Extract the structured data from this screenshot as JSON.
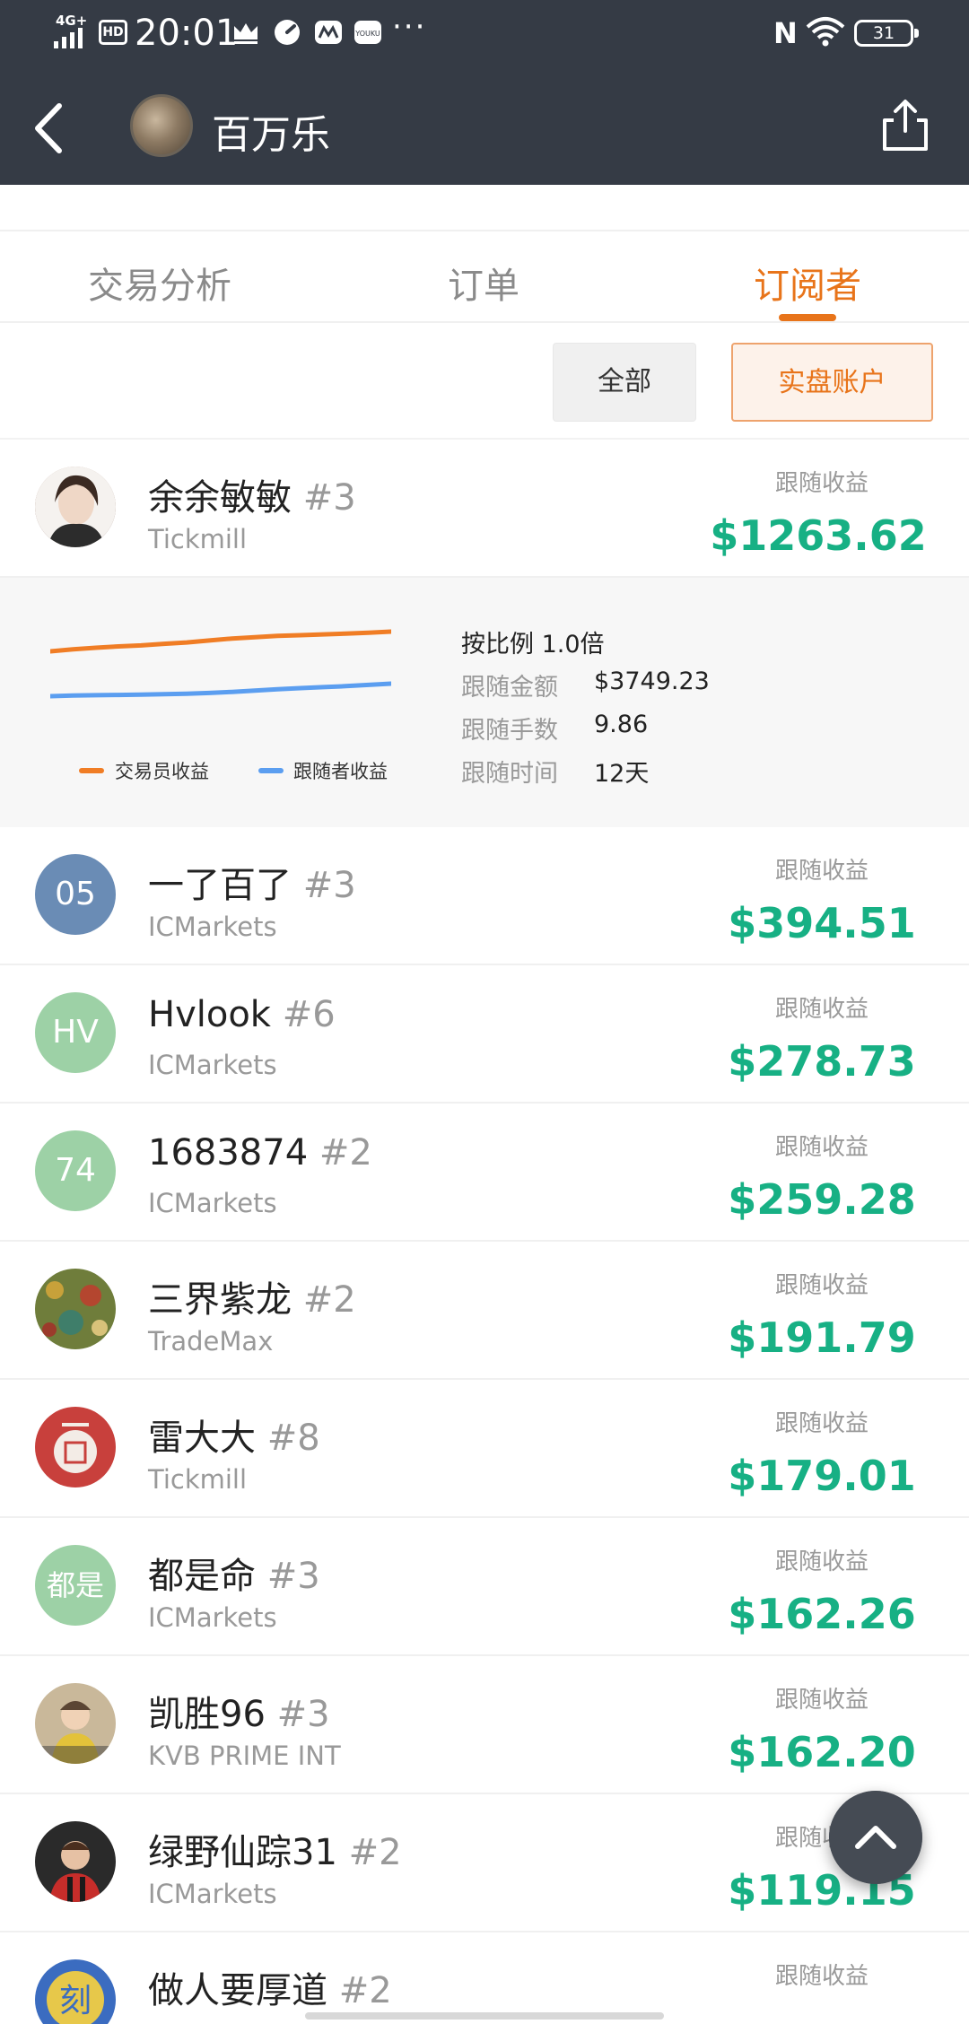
{
  "status_bar": {
    "network": "4G+",
    "hd": "HD",
    "time": "20:01",
    "more": "···",
    "nfc": "N",
    "battery": "31"
  },
  "header": {
    "title": "百万乐",
    "back_icon": "chevron-left-icon",
    "share_icon": "share-icon"
  },
  "tabs": [
    {
      "label": "交易分析",
      "active": false
    },
    {
      "label": "订单",
      "active": false
    },
    {
      "label": "订阅者",
      "active": true
    }
  ],
  "filters": {
    "all": "全部",
    "real_account": "实盘账户",
    "selected": "实盘账户"
  },
  "profit_label": "跟随收益",
  "subscribers": [
    {
      "name": "余余敏敏",
      "rank": "#3",
      "broker": "Tickmill",
      "profit": "$1263.62",
      "avatar_text": "",
      "avatar_color": "#d9c2b2"
    },
    {
      "name": "一了百了",
      "rank": "#3",
      "broker": "ICMarkets",
      "profit": "$394.51",
      "avatar_text": "05",
      "avatar_color": "#6a8cb5"
    },
    {
      "name": "Hvlook",
      "rank": "#6",
      "broker": "ICMarkets",
      "profit": "$278.73",
      "avatar_text": "HV",
      "avatar_color": "#9dd1a6"
    },
    {
      "name": "1683874",
      "rank": "#2",
      "broker": "ICMarkets",
      "profit": "$259.28",
      "avatar_text": "74",
      "avatar_color": "#9dd1a6"
    },
    {
      "name": "三界紫龙",
      "rank": "#2",
      "broker": "TradeMax",
      "profit": "$191.79",
      "avatar_text": "",
      "avatar_color": "#6f7d3b"
    },
    {
      "name": "雷大大",
      "rank": "#8",
      "broker": "Tickmill",
      "profit": "$179.01",
      "avatar_text": "",
      "avatar_color": "#c8403c"
    },
    {
      "name": "都是命",
      "rank": "#3",
      "broker": "ICMarkets",
      "profit": "$162.26",
      "avatar_text": "都是",
      "avatar_color": "#9dd1a6"
    },
    {
      "name": "凯胜96",
      "rank": "#3",
      "broker": "KVB PRIME INT",
      "profit": "$162.20",
      "avatar_text": "",
      "avatar_color": "#b3a080"
    },
    {
      "name": "绿野仙踪31",
      "rank": "#2",
      "broker": "ICMarkets",
      "profit": "$119.15",
      "avatar_text": "",
      "avatar_color": "#8a2b28"
    },
    {
      "name": "做人要厚道",
      "rank": "#2",
      "broker": "",
      "profit": "",
      "avatar_text": "",
      "avatar_color": "#3b6cc0"
    }
  ],
  "detail": {
    "ratio": "按比例 1.0倍",
    "rows": [
      {
        "label": "跟随金额",
        "value": "$3749.23"
      },
      {
        "label": "跟随手数",
        "value": "9.86"
      },
      {
        "label": "跟随时间",
        "value": "12天"
      }
    ],
    "legend": [
      {
        "name": "交易员收益",
        "color": "#f07d25"
      },
      {
        "name": "跟随者收益",
        "color": "#5b9ef0"
      }
    ]
  },
  "chart_data": {
    "type": "line",
    "series": [
      {
        "name": "交易员收益",
        "color": "#f07d25",
        "values": [
          0.0,
          0.1,
          0.18,
          0.25,
          0.3,
          0.38,
          0.45,
          0.55,
          0.65,
          0.72,
          0.78,
          0.82,
          0.86,
          0.9,
          0.94,
          1.0
        ]
      },
      {
        "name": "跟随者收益",
        "color": "#5b9ef0",
        "values": [
          0.0,
          0.05,
          0.08,
          0.1,
          0.13,
          0.16,
          0.2,
          0.26,
          0.34,
          0.45,
          0.55,
          0.64,
          0.72,
          0.8,
          0.9,
          1.0
        ]
      }
    ],
    "title": "",
    "xlabel": "",
    "ylabel": "",
    "grid": false,
    "legend_position": "bottom"
  },
  "fab": {
    "icon": "chevron-up-icon"
  }
}
